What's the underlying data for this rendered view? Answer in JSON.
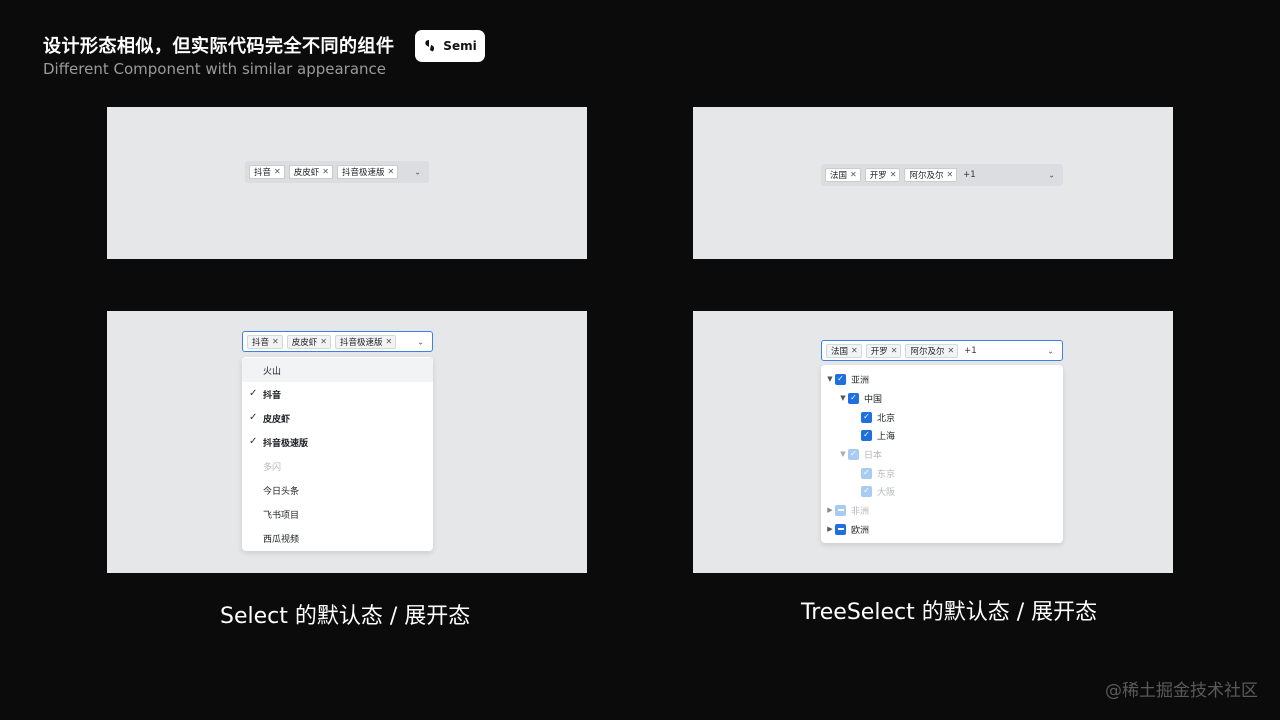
{
  "header": {
    "title": "设计形态相似，但实际代码完全不同的组件",
    "subtitle": "Different Component with similar  appearance",
    "brand": "Semi"
  },
  "select_default": {
    "tags": [
      "抖音",
      "皮皮虾",
      "抖音极速版"
    ]
  },
  "treeselect_default": {
    "tags": [
      "法国",
      "开罗",
      "阿尔及尔"
    ],
    "more": "+1"
  },
  "select_open": {
    "tags": [
      "抖音",
      "皮皮虾",
      "抖音极速版"
    ],
    "options": [
      {
        "label": "火山",
        "state": "hover"
      },
      {
        "label": "抖音",
        "state": "selected"
      },
      {
        "label": "皮皮虾",
        "state": "selected"
      },
      {
        "label": "抖音极速版",
        "state": "selected"
      },
      {
        "label": "多闪",
        "state": "disabled"
      },
      {
        "label": "今日头条",
        "state": "normal"
      },
      {
        "label": "飞书项目",
        "state": "normal"
      },
      {
        "label": "西瓜视频",
        "state": "normal"
      }
    ]
  },
  "treeselect_open": {
    "tags": [
      "法国",
      "开罗",
      "阿尔及尔"
    ],
    "more": "+1",
    "tree": [
      {
        "label": "亚洲",
        "level": 0,
        "caret": "expanded",
        "check": "checked",
        "disabled": false
      },
      {
        "label": "中国",
        "level": 1,
        "caret": "expanded",
        "check": "checked",
        "disabled": false
      },
      {
        "label": "北京",
        "level": 2,
        "caret": "none",
        "check": "checked",
        "disabled": false
      },
      {
        "label": "上海",
        "level": 2,
        "caret": "none",
        "check": "checked",
        "disabled": false
      },
      {
        "label": "日本",
        "level": 1,
        "caret": "expanded",
        "check": "checked",
        "disabled": true
      },
      {
        "label": "东京",
        "level": 2,
        "caret": "none",
        "check": "checked",
        "disabled": true
      },
      {
        "label": "大阪",
        "level": 2,
        "caret": "none",
        "check": "checked",
        "disabled": true
      },
      {
        "label": "非洲",
        "level": 0,
        "caret": "collapsed",
        "check": "indeterminate",
        "disabled": true
      },
      {
        "label": "欧洲",
        "level": 0,
        "caret": "collapsed",
        "check": "indeterminate",
        "disabled": false
      }
    ]
  },
  "captions": {
    "select": "Select 的默认态 / 展开态",
    "treeselect": "TreeSelect 的默认态 / 展开态"
  },
  "watermark": "@稀土掘金技术社区",
  "colors": {
    "background": "#0b0b0b",
    "panel": "#e6e7e9",
    "primary": "#1f6fe0",
    "primary_light": "#a8cbf4"
  }
}
